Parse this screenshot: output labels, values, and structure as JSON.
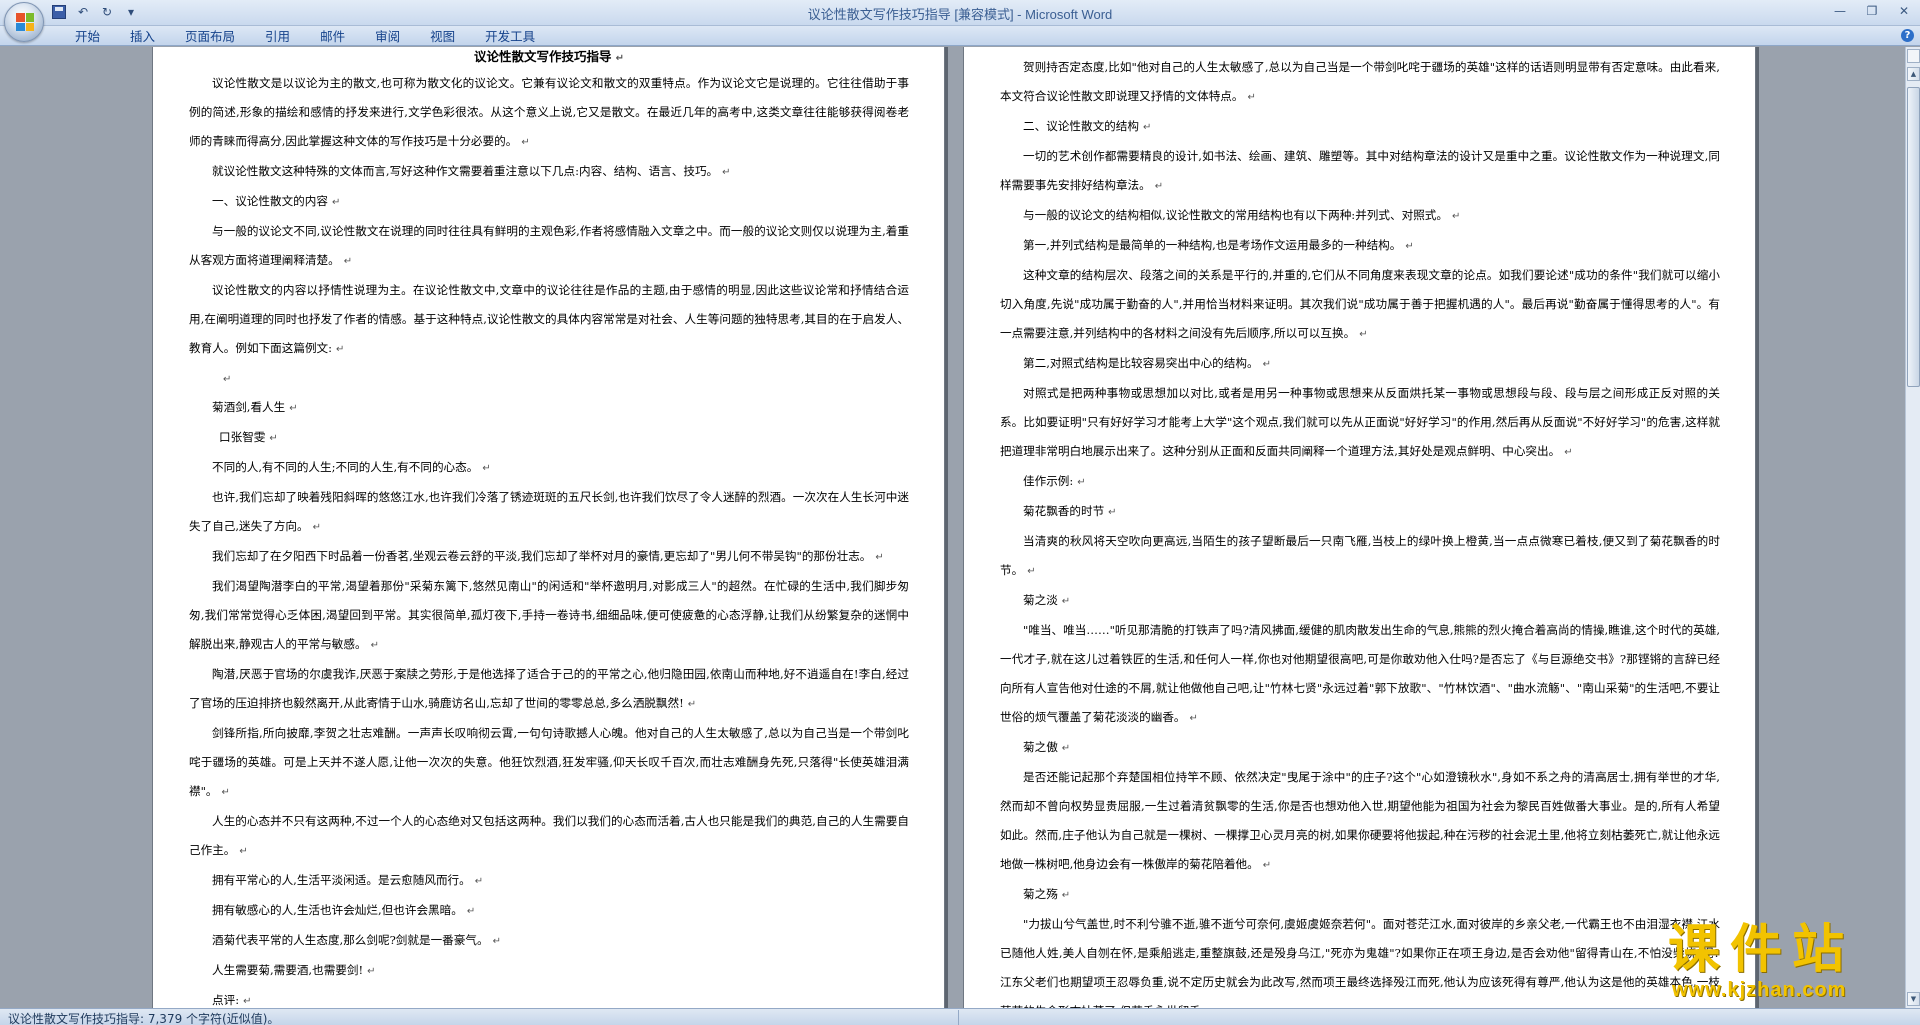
{
  "window": {
    "title": "议论性散文写作技巧指导 [兼容模式] - Microsoft Word"
  },
  "quick_access": {
    "undo_symbol": "↶",
    "redo_symbol": "↻",
    "dropdown_symbol": "▾"
  },
  "window_controls": {
    "minimize": "—",
    "maximize": "❐",
    "close": "✕"
  },
  "ribbon": {
    "tabs": [
      {
        "label": "开始"
      },
      {
        "label": "插入"
      },
      {
        "label": "页面布局"
      },
      {
        "label": "引用"
      },
      {
        "label": "邮件"
      },
      {
        "label": "审阅"
      },
      {
        "label": "视图"
      },
      {
        "label": "开发工具"
      }
    ],
    "help": "?"
  },
  "paragraph_mark": "↵",
  "left_page": {
    "title": "议论性散文写作技巧指导",
    "paragraphs": [
      "议论性散文是以议论为主的散文,也可称为散文化的议论文。它兼有议论文和散文的双重特点。作为议论文它是说理的。它往往借助于事例的简述,形象的描绘和感情的抒发来进行,文学色彩很浓。从这个意义上说,它又是散文。在最近几年的高考中,这类文章往往能够获得阅卷老师的青睐而得高分,因此掌握这种文体的写作技巧是十分必要的。",
      "就议论性散文这种特殊的文体而言,写好这种作文需要着重注意以下几点:内容、结构、语言、技巧。",
      "一、议论性散文的内容",
      "与一般的议论文不同,议论性散文在说理的同时往往具有鲜明的主观色彩,作者将感情融入文章之中。而一般的议论文则仅以说理为主,着重从客观方面将道理阐释清楚。",
      "议论性散文的内容以抒情性说理为主。在议论性散文中,文章中的议论往往是作品的主题,由于感情的明显,因此这些议论常和抒情结合运用,在阐明道理的同时也抒发了作者的情感。基于这种特点,议论性散文的具体内容常常是对社会、人生等问题的独特思考,其目的在于启发人、教育人。例如下面这篇例文:",
      "",
      "菊酒剑,看人生",
      "口张智雯",
      "不同的人,有不同的人生;不同的人生,有不同的心态。",
      "也许,我们忘却了映着残阳斜晖的悠悠江水,也许我们冷落了锈迹斑斑的五尺长剑,也许我们饮尽了令人迷醉的烈酒。一次次在人生长河中迷失了自己,迷失了方向。",
      "我们忘却了在夕阳西下时品着一份香茗,坐观云卷云舒的平淡,我们忘却了举杯对月的豪情,更忘却了\"男儿何不带吴钩\"的那份壮志。",
      "我们渴望陶潜李白的平常,渴望着那份\"采菊东篱下,悠然见南山\"的闲适和\"举杯邀明月,对影成三人\"的超然。在忙碌的生活中,我们脚步匆匆,我们常常觉得心乏体困,渴望回到平常。其实很简单,孤灯夜下,手持一卷诗书,细细品味,便可使疲惫的心态浮静,让我们从纷繁复杂的迷惘中解脱出来,静观古人的平常与敏感。",
      "陶潜,厌恶于官场的尔虞我诈,厌恶于案牍之劳形,于是他选择了适合于己的的平常之心,他归隐田园,依南山而种地,好不逍遥自在!李白,经过了官场的压迫排挤也毅然离开,从此寄情于山水,骑鹿访名山,忘却了世间的零零总总,多么洒脱飘然!",
      "剑锋所指,所向披靡,李贺之壮志难酬。一声声长叹响彻云霄,一句句诗歌撼人心魄。他对自己的人生太敏感了,总以为自己当是一个带剑叱咤于疆场的英雄。可是上天并不遂人愿,让他一次次的失意。他狂饮烈酒,狂发牢骚,仰天长叹千百次,而壮志难酬身先死,只落得\"长使英雄泪满襟\"。",
      "人生的心态并不只有这两种,不过一个人的心态绝对又包括这两种。我们以我们的心态而活着,古人也只能是我们的典范,自己的人生需要自己作主。",
      "拥有平常心的人,生活平淡闲适。是云愈随风而行。",
      "拥有敏感心的人,生活也许会灿烂,但也许会黑暗。",
      "酒菊代表平常的人生态度,那么剑呢?剑就是一番豪气。",
      "人生需要菊,需要酒,也需要剑!",
      "点评:"
    ]
  },
  "right_page": {
    "paragraphs": [
      "贺则持否定态度,比如\"他对自己的人生太敏感了,总以为自己当是一个带剑叱咤于疆场的英雄\"这样的话语则明显带有否定意味。由此看来,本文符合议论性散文即说理又抒情的文体特点。",
      "二、议论性散文的结构",
      "一切的艺术创作都需要精良的设计,如书法、绘画、建筑、雕塑等。其中对结构章法的设计又是重中之重。议论性散文作为一种说理文,同样需要事先安排好结构章法。",
      "与一般的议论文的结构相似,议论性散文的常用结构也有以下两种:并列式、对照式。",
      "第一,并列式结构是最简单的一种结构,也是考场作文运用最多的一种结构。",
      "这种文章的结构层次、段落之间的关系是平行的,并重的,它们从不同角度来表现文章的论点。如我们要论述\"成功的条件\"我们就可以缩小切入角度,先说\"成功属于勤奋的人\",并用恰当材料来证明。其次我们说\"成功属于善于把握机遇的人\"。最后再说\"勤奋属于懂得思考的人\"。有一点需要注意,并列结构中的各材料之间没有先后顺序,所以可以互换。",
      "第二,对照式结构是比较容易突出中心的结构。",
      "对照式是把两种事物或思想加以对比,或者是用另一种事物或思想来从反面烘托某一事物或思想段与段、段与层之间形成正反对照的关系。比如要证明\"只有好好学习才能考上大学\"这个观点,我们就可以先从正面说\"好好学习\"的作用,然后再从反面说\"不好好学习\"的危害,这样就把道理非常明白地展示出来了。这种分别从正面和反面共同阐释一个道理方法,其好处是观点鲜明、中心突出。",
      "佳作示例:",
      "菊花飘香的时节",
      "当清爽的秋风将天空吹向更高远,当陌生的孩子望断最后一只南飞雁,当枝上的绿叶换上橙黄,当一点点微寒已着枝,便又到了菊花飘香的时节。",
      "菊之淡",
      "\"唯当、唯当……\"听见那清脆的打铁声了吗?清风拂面,缓健的肌肉散发出生命的气息,熊熊的烈火掩合着高尚的情操,瞧谁,这个时代的英雄,一代才子,就在这儿过着铁匠的生活,和任何人一样,你也对他期望很高吧,可是你敢劝他入仕吗?是否忘了《与巨源绝交书》?那铿锵的言辞已经向所有人宣告他对仕途的不屑,就让他做他自己吧,让\"竹林七贤\"永远过着\"郭下放歌\"、\"竹林饮酒\"、\"曲水流觞\"、\"南山采菊\"的生活吧,不要让世俗的烦气覆盖了菊花淡淡的幽香。",
      "菊之傲",
      "是否还能记起那个弃楚国相位持竿不顾、依然决定\"曳尾于涂中\"的庄子?这个\"心如澄镜秋水\",身如不系之舟的清高居士,拥有举世的才华,然而却不曾向权势显贵屈服,一生过着清贫飘零的生活,你是否也想劝他入世,期望他能为祖国为社会为黎民百姓做番大事业。是的,所有人希望如此。然而,庄子他认为自己就是一棵树、一棵撑卫心灵月亮的树,如果你硬要将他拔起,种在污秽的社会泥土里,他将立刻枯萎死亡,就让他永远地做一株树吧,他身边会有一株傲岸的菊花陪着他。",
      "菊之殇",
      "\"力拔山兮气盖世,时不利兮骓不逝,骓不逝兮可奈何,虞姬虞姬奈若何\"。面对苍茫江水,面对彼岸的乡亲父老,一代霸王也不由泪湿衣襟,江水已随他人姓,美人自刎在怀,是乘船逃走,重整旗鼓,还是殁身乌江,\"死亦为鬼雄\"?如果你正在项王身边,是否会劝他\"留得青山在,不怕没柴烧\"呢?江东父老们也期望项王忍辱负重,说不定历史就会为此改写,然而项王最终选择殁江而死,他认为应该死得有尊严,他认为这是他的英雄本色,一枝菊花的生命形态枯萎了,但花香永世留香。"
    ]
  },
  "status_bar": {
    "text": "议论性散文写作技巧指导: 7,379 个字符(近似值)。"
  },
  "scrollbar": {
    "up_symbol": "▲",
    "down_symbol": "▼"
  },
  "watermark": {
    "title": "课件站",
    "url": "www.kjzhan.com"
  }
}
